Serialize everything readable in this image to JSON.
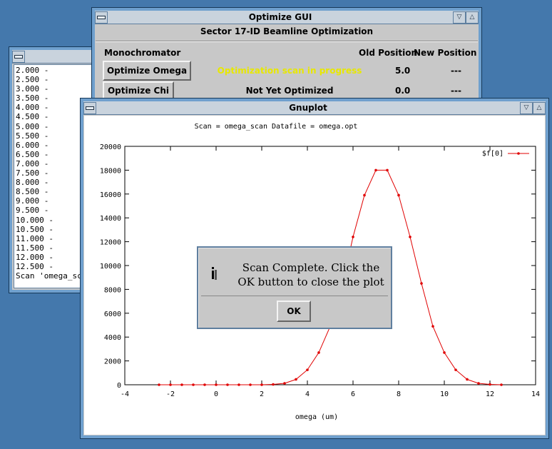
{
  "console": {
    "lines": [
      "2.000 -",
      "2.500 -",
      "3.000 -",
      "3.500 -",
      "4.000 -",
      "4.500 -",
      "5.000 -",
      "5.500 -",
      "6.000 -",
      "6.500 -",
      "7.000 -",
      "7.500 -",
      "8.000 -",
      "8.500 -",
      "9.000 -",
      "9.500 -",
      "10.000 -",
      "10.500 -",
      "11.000 -",
      "11.500 -",
      "12.000 -",
      "12.500 -",
      "Scan 'omega_sc"
    ]
  },
  "optimize_gui": {
    "title": "Optimize GUI",
    "subtitle": "Sector 17-ID Beamline Optimization",
    "section": "Monochromator",
    "col_old": "Old Position",
    "col_new": "New Position",
    "rows": [
      {
        "button": "Optimize Omega",
        "status": "Optimization scan in progress",
        "status_color": "#e8e800",
        "old": "5.0",
        "new": "---"
      },
      {
        "button": "Optimize Chi",
        "status": "Not Yet Optimized",
        "status_color": "#000000",
        "old": "0.0",
        "new": "---"
      }
    ]
  },
  "gnuplot": {
    "title": "Gnuplot",
    "header": "Scan = omega_scan  Datafile = omega.opt"
  },
  "chart_data": {
    "type": "line",
    "title": "Scan = omega_scan  Datafile = omega.opt",
    "xlabel": "omega (um)",
    "ylabel": "",
    "xlim": [
      -4,
      14
    ],
    "ylim": [
      0,
      20000
    ],
    "xticks": [
      -4,
      -2,
      0,
      2,
      4,
      6,
      8,
      10,
      12,
      14
    ],
    "yticks": [
      0,
      2000,
      4000,
      6000,
      8000,
      10000,
      12000,
      14000,
      16000,
      18000,
      20000
    ],
    "grid": false,
    "legend_position": "top-right",
    "line_color": "#e00000",
    "series": [
      {
        "name": "$f[0]",
        "x": [
          -2.5,
          -2.0,
          -1.5,
          -1.0,
          -0.5,
          0.0,
          0.5,
          1.0,
          1.5,
          2.0,
          2.5,
          3.0,
          3.5,
          4.0,
          4.5,
          5.0,
          5.5,
          6.0,
          6.5,
          7.0,
          7.5,
          8.0,
          8.5,
          9.0,
          9.5,
          10.0,
          10.5,
          11.0,
          11.5,
          12.0,
          12.5
        ],
        "y": [
          0,
          0,
          0,
          0,
          0,
          0,
          0,
          0,
          0,
          0,
          30,
          120,
          450,
          1250,
          2700,
          4900,
          8100,
          12400,
          15900,
          18000,
          18000,
          15900,
          12400,
          8500,
          4900,
          2700,
          1250,
          450,
          120,
          30,
          0
        ]
      }
    ]
  },
  "dialog": {
    "message_line1": "Scan Complete.  Click the",
    "message_line2": "OK button to close the plot",
    "ok_label": "OK"
  }
}
